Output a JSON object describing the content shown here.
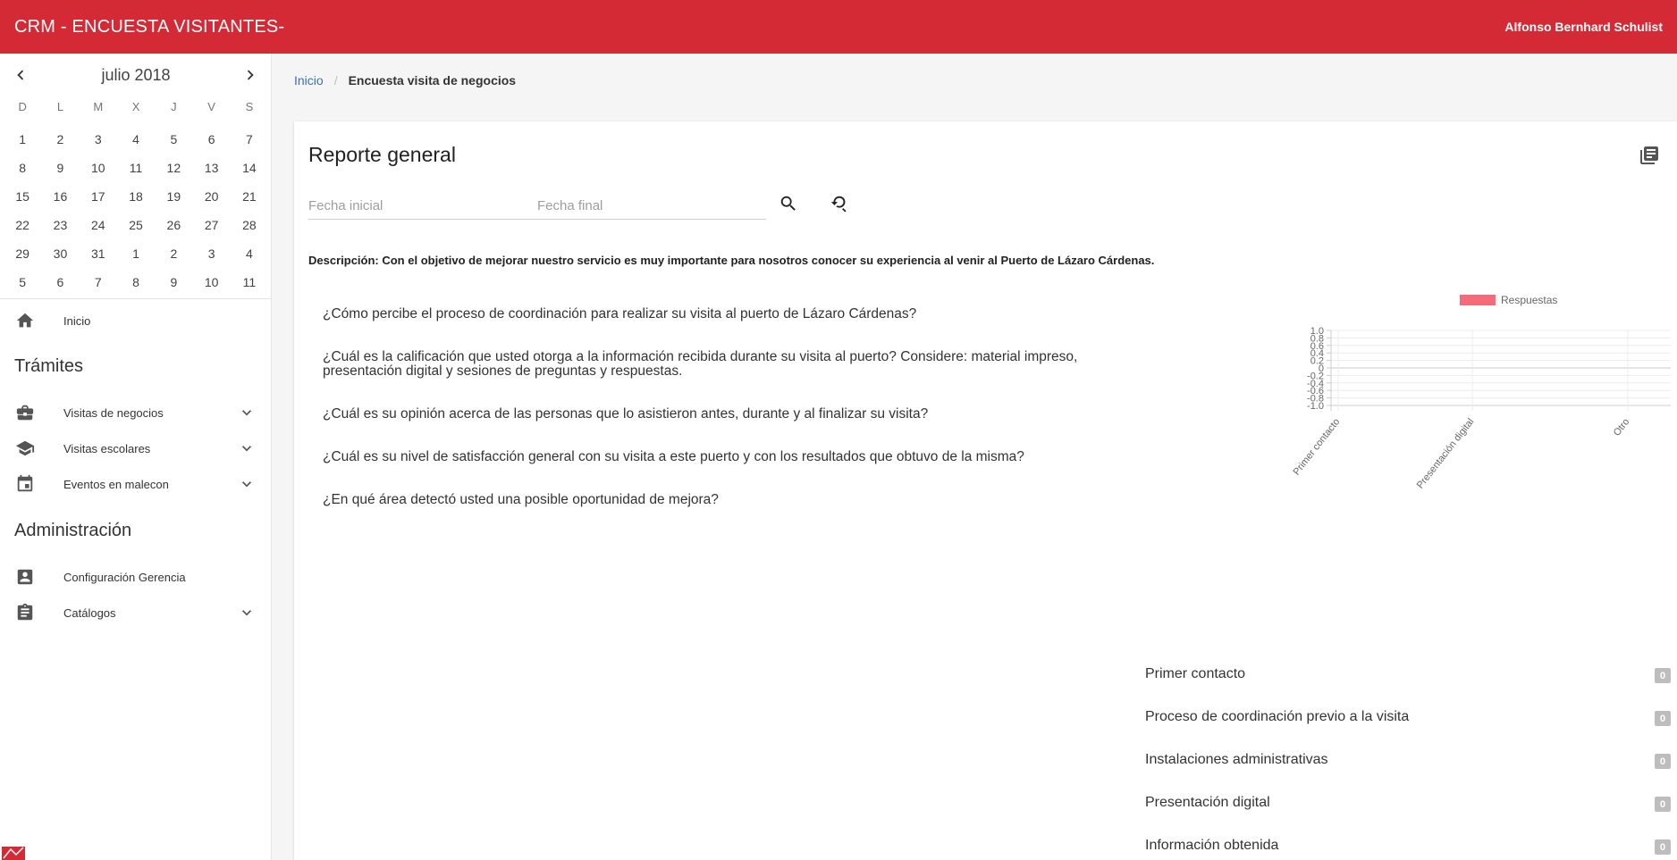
{
  "header": {
    "app_title": "CRM - ENCUESTA VISITANTES-",
    "user_name": "Alfonso Bernhard Schulist"
  },
  "calendar": {
    "month_label": "julio 2018",
    "weekdays": [
      "D",
      "L",
      "M",
      "X",
      "J",
      "V",
      "S"
    ],
    "days": [
      "1",
      "2",
      "3",
      "4",
      "5",
      "6",
      "7",
      "8",
      "9",
      "10",
      "11",
      "12",
      "13",
      "14",
      "15",
      "16",
      "17",
      "18",
      "19",
      "20",
      "21",
      "22",
      "23",
      "24",
      "25",
      "26",
      "27",
      "28",
      "29",
      "30",
      "31",
      "1",
      "2",
      "3",
      "4",
      "5",
      "6",
      "7",
      "8",
      "9",
      "10",
      "11"
    ]
  },
  "sidebar": {
    "home_label": "Inicio",
    "tramites_title": "Trámites",
    "tramites": [
      {
        "label": "Visitas de negocios",
        "icon": "briefcase-icon"
      },
      {
        "label": "Visitas escolares",
        "icon": "school-icon"
      },
      {
        "label": "Eventos en malecon",
        "icon": "calendar-icon"
      }
    ],
    "admin_title": "Administración",
    "admin": [
      {
        "label": "Configuración Gerencia",
        "icon": "account-box-icon"
      },
      {
        "label": "Catálogos",
        "icon": "clipboard-icon"
      }
    ]
  },
  "breadcrumb": {
    "home": "Inicio",
    "current": "Encuesta visita de negocios"
  },
  "report": {
    "title": "Reporte general",
    "start_placeholder": "Fecha inicial",
    "end_placeholder": "Fecha final",
    "description": "Descripción: Con el objetivo de mejorar nuestro servicio es muy importante para nosotros conocer su experiencia al venir al Puerto de Lázaro Cárdenas.",
    "questions": [
      "¿Cómo percibe el proceso de coordinación para realizar su visita al puerto de Lázaro Cárdenas?",
      "¿Cuál es la calificación que usted otorga a la información recibida durante su visita al puerto? Considere: material impreso, presentación digital y sesiones de preguntas y respuestas.",
      "¿Cuál es su opinión acerca de las personas que lo asistieron antes, durante y al finalizar su visita?",
      "¿Cuál es su nivel de satisfacción general con su visita a este puerto y con los resultados que obtuvo de la misma?",
      "¿En qué área detectó usted una posible oportunidad de mejora?"
    ],
    "counts": [
      {
        "label": "Primer contacto",
        "value": "0"
      },
      {
        "label": "Proceso de coordinación previo a la visita",
        "value": "0"
      },
      {
        "label": "Instalaciones administrativas",
        "value": "0"
      },
      {
        "label": "Presentación digital",
        "value": "0"
      },
      {
        "label": "Información obtenida",
        "value": "0"
      }
    ]
  },
  "chart_data": {
    "type": "bar",
    "categories": [
      "Primer contacto",
      "Presentación digital",
      "Otro"
    ],
    "series": [
      {
        "name": "Respuestas",
        "values": [
          0,
          0,
          0
        ],
        "color": "#f56b7a"
      }
    ],
    "ylim": [
      -1.0,
      1.0
    ],
    "yticks": [
      "1.0",
      "0.8",
      "0.6",
      "0.4",
      "0.2",
      "0",
      "-0.2",
      "-0.4",
      "-0.6",
      "-0.8",
      "-1.0"
    ],
    "legend": "top",
    "grid": true
  },
  "colors": {
    "brand": "#d32a35",
    "link": "#3f6fb3",
    "badge": "#bdbdbd"
  }
}
